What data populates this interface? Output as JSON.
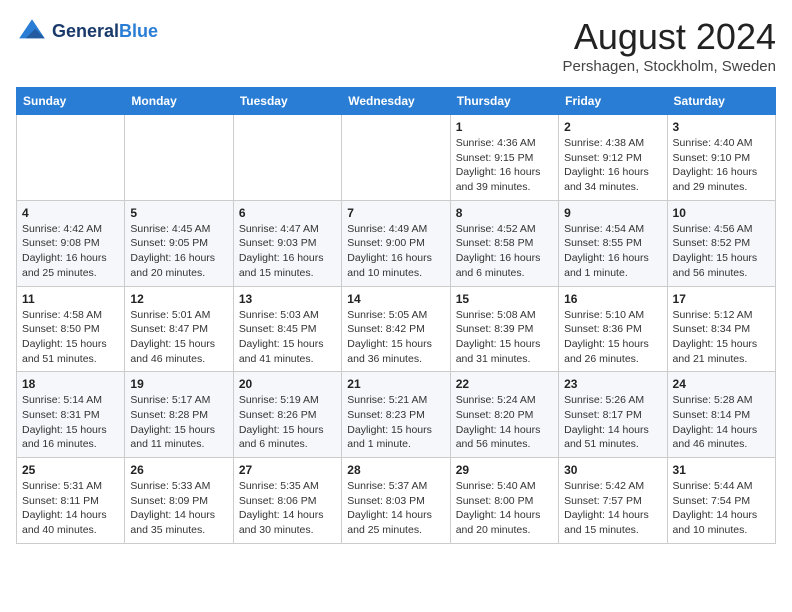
{
  "header": {
    "logo_line1": "General",
    "logo_line2": "Blue",
    "title": "August 2024",
    "subtitle": "Pershagen, Stockholm, Sweden"
  },
  "weekdays": [
    "Sunday",
    "Monday",
    "Tuesday",
    "Wednesday",
    "Thursday",
    "Friday",
    "Saturday"
  ],
  "weeks": [
    [
      {
        "day": "",
        "info": ""
      },
      {
        "day": "",
        "info": ""
      },
      {
        "day": "",
        "info": ""
      },
      {
        "day": "",
        "info": ""
      },
      {
        "day": "1",
        "info": "Sunrise: 4:36 AM\nSunset: 9:15 PM\nDaylight: 16 hours\nand 39 minutes."
      },
      {
        "day": "2",
        "info": "Sunrise: 4:38 AM\nSunset: 9:12 PM\nDaylight: 16 hours\nand 34 minutes."
      },
      {
        "day": "3",
        "info": "Sunrise: 4:40 AM\nSunset: 9:10 PM\nDaylight: 16 hours\nand 29 minutes."
      }
    ],
    [
      {
        "day": "4",
        "info": "Sunrise: 4:42 AM\nSunset: 9:08 PM\nDaylight: 16 hours\nand 25 minutes."
      },
      {
        "day": "5",
        "info": "Sunrise: 4:45 AM\nSunset: 9:05 PM\nDaylight: 16 hours\nand 20 minutes."
      },
      {
        "day": "6",
        "info": "Sunrise: 4:47 AM\nSunset: 9:03 PM\nDaylight: 16 hours\nand 15 minutes."
      },
      {
        "day": "7",
        "info": "Sunrise: 4:49 AM\nSunset: 9:00 PM\nDaylight: 16 hours\nand 10 minutes."
      },
      {
        "day": "8",
        "info": "Sunrise: 4:52 AM\nSunset: 8:58 PM\nDaylight: 16 hours\nand 6 minutes."
      },
      {
        "day": "9",
        "info": "Sunrise: 4:54 AM\nSunset: 8:55 PM\nDaylight: 16 hours\nand 1 minute."
      },
      {
        "day": "10",
        "info": "Sunrise: 4:56 AM\nSunset: 8:52 PM\nDaylight: 15 hours\nand 56 minutes."
      }
    ],
    [
      {
        "day": "11",
        "info": "Sunrise: 4:58 AM\nSunset: 8:50 PM\nDaylight: 15 hours\nand 51 minutes."
      },
      {
        "day": "12",
        "info": "Sunrise: 5:01 AM\nSunset: 8:47 PM\nDaylight: 15 hours\nand 46 minutes."
      },
      {
        "day": "13",
        "info": "Sunrise: 5:03 AM\nSunset: 8:45 PM\nDaylight: 15 hours\nand 41 minutes."
      },
      {
        "day": "14",
        "info": "Sunrise: 5:05 AM\nSunset: 8:42 PM\nDaylight: 15 hours\nand 36 minutes."
      },
      {
        "day": "15",
        "info": "Sunrise: 5:08 AM\nSunset: 8:39 PM\nDaylight: 15 hours\nand 31 minutes."
      },
      {
        "day": "16",
        "info": "Sunrise: 5:10 AM\nSunset: 8:36 PM\nDaylight: 15 hours\nand 26 minutes."
      },
      {
        "day": "17",
        "info": "Sunrise: 5:12 AM\nSunset: 8:34 PM\nDaylight: 15 hours\nand 21 minutes."
      }
    ],
    [
      {
        "day": "18",
        "info": "Sunrise: 5:14 AM\nSunset: 8:31 PM\nDaylight: 15 hours\nand 16 minutes."
      },
      {
        "day": "19",
        "info": "Sunrise: 5:17 AM\nSunset: 8:28 PM\nDaylight: 15 hours\nand 11 minutes."
      },
      {
        "day": "20",
        "info": "Sunrise: 5:19 AM\nSunset: 8:26 PM\nDaylight: 15 hours\nand 6 minutes."
      },
      {
        "day": "21",
        "info": "Sunrise: 5:21 AM\nSunset: 8:23 PM\nDaylight: 15 hours\nand 1 minute."
      },
      {
        "day": "22",
        "info": "Sunrise: 5:24 AM\nSunset: 8:20 PM\nDaylight: 14 hours\nand 56 minutes."
      },
      {
        "day": "23",
        "info": "Sunrise: 5:26 AM\nSunset: 8:17 PM\nDaylight: 14 hours\nand 51 minutes."
      },
      {
        "day": "24",
        "info": "Sunrise: 5:28 AM\nSunset: 8:14 PM\nDaylight: 14 hours\nand 46 minutes."
      }
    ],
    [
      {
        "day": "25",
        "info": "Sunrise: 5:31 AM\nSunset: 8:11 PM\nDaylight: 14 hours\nand 40 minutes."
      },
      {
        "day": "26",
        "info": "Sunrise: 5:33 AM\nSunset: 8:09 PM\nDaylight: 14 hours\nand 35 minutes."
      },
      {
        "day": "27",
        "info": "Sunrise: 5:35 AM\nSunset: 8:06 PM\nDaylight: 14 hours\nand 30 minutes."
      },
      {
        "day": "28",
        "info": "Sunrise: 5:37 AM\nSunset: 8:03 PM\nDaylight: 14 hours\nand 25 minutes."
      },
      {
        "day": "29",
        "info": "Sunrise: 5:40 AM\nSunset: 8:00 PM\nDaylight: 14 hours\nand 20 minutes."
      },
      {
        "day": "30",
        "info": "Sunrise: 5:42 AM\nSunset: 7:57 PM\nDaylight: 14 hours\nand 15 minutes."
      },
      {
        "day": "31",
        "info": "Sunrise: 5:44 AM\nSunset: 7:54 PM\nDaylight: 14 hours\nand 10 minutes."
      }
    ]
  ]
}
